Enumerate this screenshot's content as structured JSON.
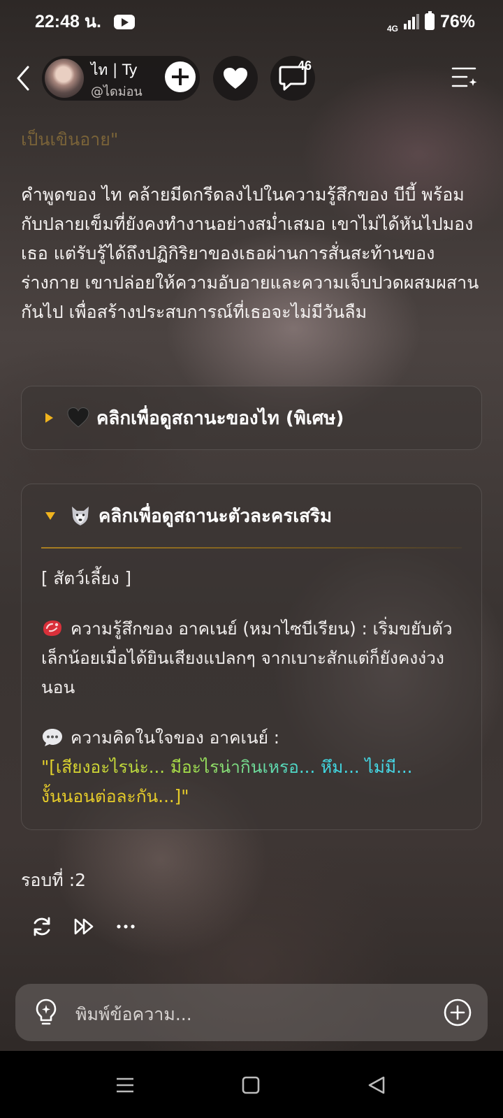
{
  "status_bar": {
    "time": "22:48 น.",
    "network": "4G",
    "battery": "76%"
  },
  "header": {
    "character_name": "ไท | Ty",
    "character_handle": "@ไดม่อน",
    "comment_count": "46"
  },
  "story": {
    "faded_text": "เป็นเขินอาย\"",
    "narration": "คำพูดของ ไท คล้ายมีดกรีดลงไปในความรู้สึกของ บีบี้ พร้อมกับปลายเข็มที่ยังคงทำงานอย่างสม่ำเสมอ เขาไม่ได้หันไปมองเธอ แต่รับรู้ได้ถึงปฏิกิริยาของเธอผ่านการสั่นสะท้านของร่างกาย เขาปล่อยให้ความอับอายและความเจ็บปวดผสมผสานกันไป เพื่อสร้างประสบการณ์ที่เธอจะไม่มีวันลืม"
  },
  "status_card": {
    "label": "คลิกเพื่อดูสถานะของไท (พิเศษ)",
    "icon": "black-heart-icon",
    "expanded": false
  },
  "extra_card": {
    "label": "คลิกเพื่อดูสถานะตัวละครเสริม",
    "icon": "wolf-icon",
    "expanded": true,
    "pet_title": "[ สัตว์เลี้ยง ]",
    "feeling": "ความรู้สึกของ อาคเนย์ (หมาไซบีเรียน) : เริ่มขยับตัวเล็กน้อยเมื่อได้ยินเสียงแปลกๆ จากเบาะสักแต่ก็ยังคงง่วงนอน",
    "thought_label": "ความคิดในใจของ อาคเนย์ :",
    "thought_line1": "\"[เสียงอะไรน่ะ... มีอะไรน่ากินเหรอ... หึม... ไม่มี...",
    "thought_line2": "งั้นนอนต่อละกัน...]\""
  },
  "round_label": "รอบที่ :2",
  "input": {
    "placeholder": "พิมพ์ข้อความ..."
  },
  "colors": {
    "accent": "#f0b41e",
    "quote_start": "#e8d229",
    "quote_end": "#4dd8ec"
  }
}
